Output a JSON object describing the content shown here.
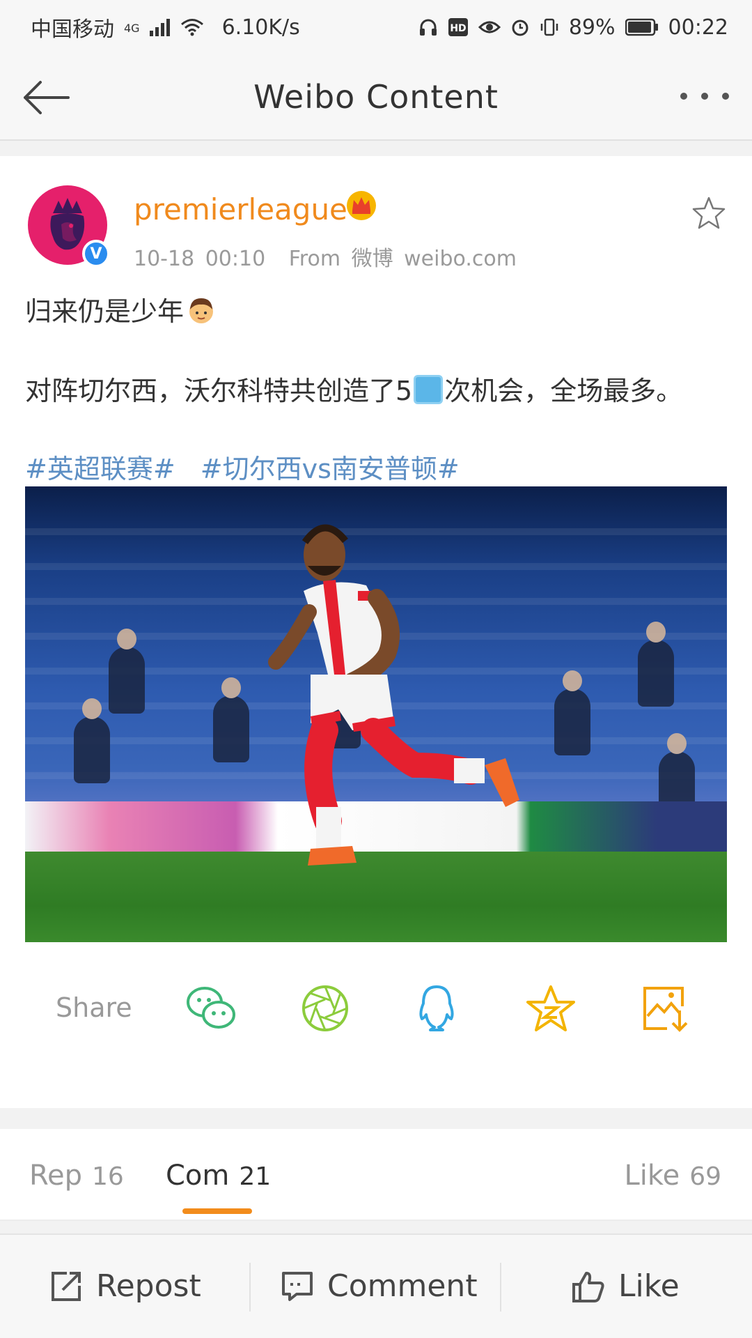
{
  "status_bar": {
    "carrier": "中国移动",
    "network": "4G",
    "speed": "6.10K/s",
    "battery": "89%",
    "time": "00:22"
  },
  "header": {
    "title": "Weibo  Content",
    "back_icon": "back-arrow-icon",
    "more_icon": "more-dots-icon"
  },
  "post": {
    "username": "premierleague",
    "timestamp": "10-18  00:10",
    "source": "From  微博  weibo.com",
    "line1": "归来仍是少年",
    "line2_before": "对阵切尔西，沃尔科特共创造了5",
    "line2_after": "次机会，全场最多。",
    "tags": [
      "#英超联赛#",
      "#切尔西vs南安普顿#"
    ],
    "image_alt": "Football player in red and white kit running on pitch",
    "colors": {
      "username": "#f08a1d",
      "tag": "#5d8fc4",
      "avatar": "#e5206b",
      "verified": "#2a8cef"
    }
  },
  "share": {
    "label": "Share",
    "icons": [
      "wechat-icon",
      "moments-icon",
      "qq-icon",
      "qzone-icon",
      "save-image-icon"
    ]
  },
  "tabs": {
    "repost": {
      "label": "Rep",
      "count": "16"
    },
    "comment": {
      "label": "Com",
      "count": "21"
    },
    "like": {
      "label": "Like",
      "count": "69"
    },
    "active_color": "#f28c1c"
  },
  "bottom_bar": {
    "repost": "Repost",
    "comment": "Comment",
    "like": "Like"
  }
}
